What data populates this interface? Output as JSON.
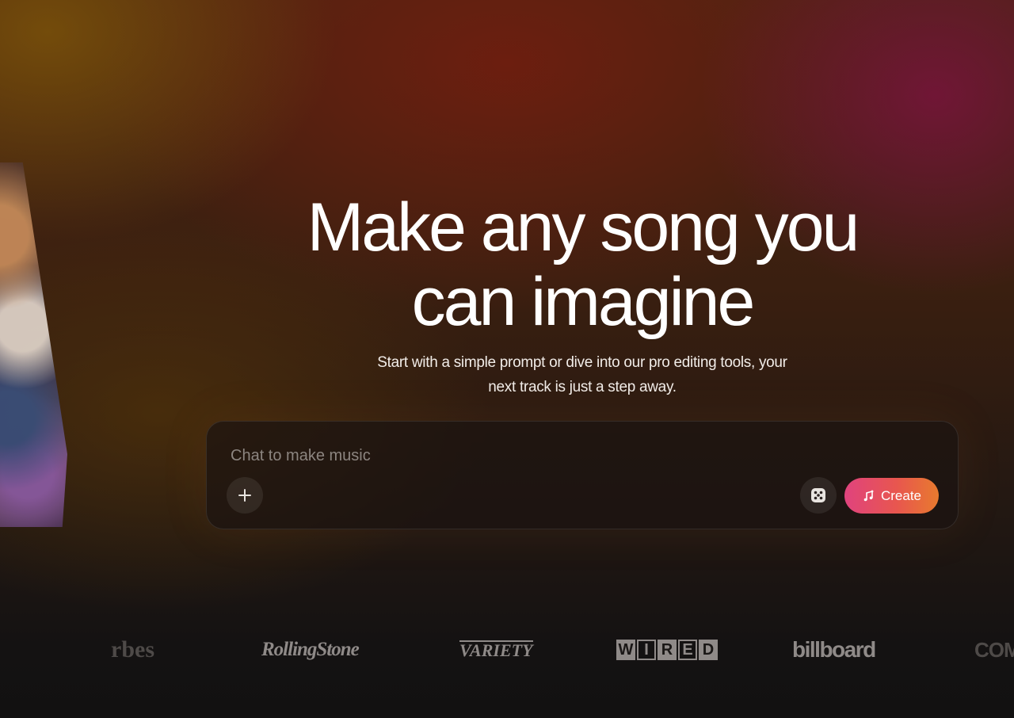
{
  "hero": {
    "title_line1": "Make any song you",
    "title_line2": "can imagine",
    "subtitle": "Start with a simple prompt or dive into our pro editing tools, your next track is just a step away."
  },
  "chat": {
    "placeholder": "Chat to make music",
    "value": "",
    "add_icon": "plus-icon",
    "random_icon": "dice-icon",
    "create_label": "Create",
    "create_icon": "music-note-icon",
    "create_gradient": [
      "#e0437e",
      "#e87a2e"
    ]
  },
  "press_logos": {
    "forbes": "rbes",
    "rolling_stone": "RollingStone",
    "variety": "VARIETY",
    "wired": [
      "W",
      "I",
      "R",
      "E",
      "D"
    ],
    "billboard": "billboard",
    "partial": "COM"
  },
  "colors": {
    "background_top": "#4a2412",
    "background_bottom": "#121111",
    "logo_gray": "#8f8a88"
  }
}
